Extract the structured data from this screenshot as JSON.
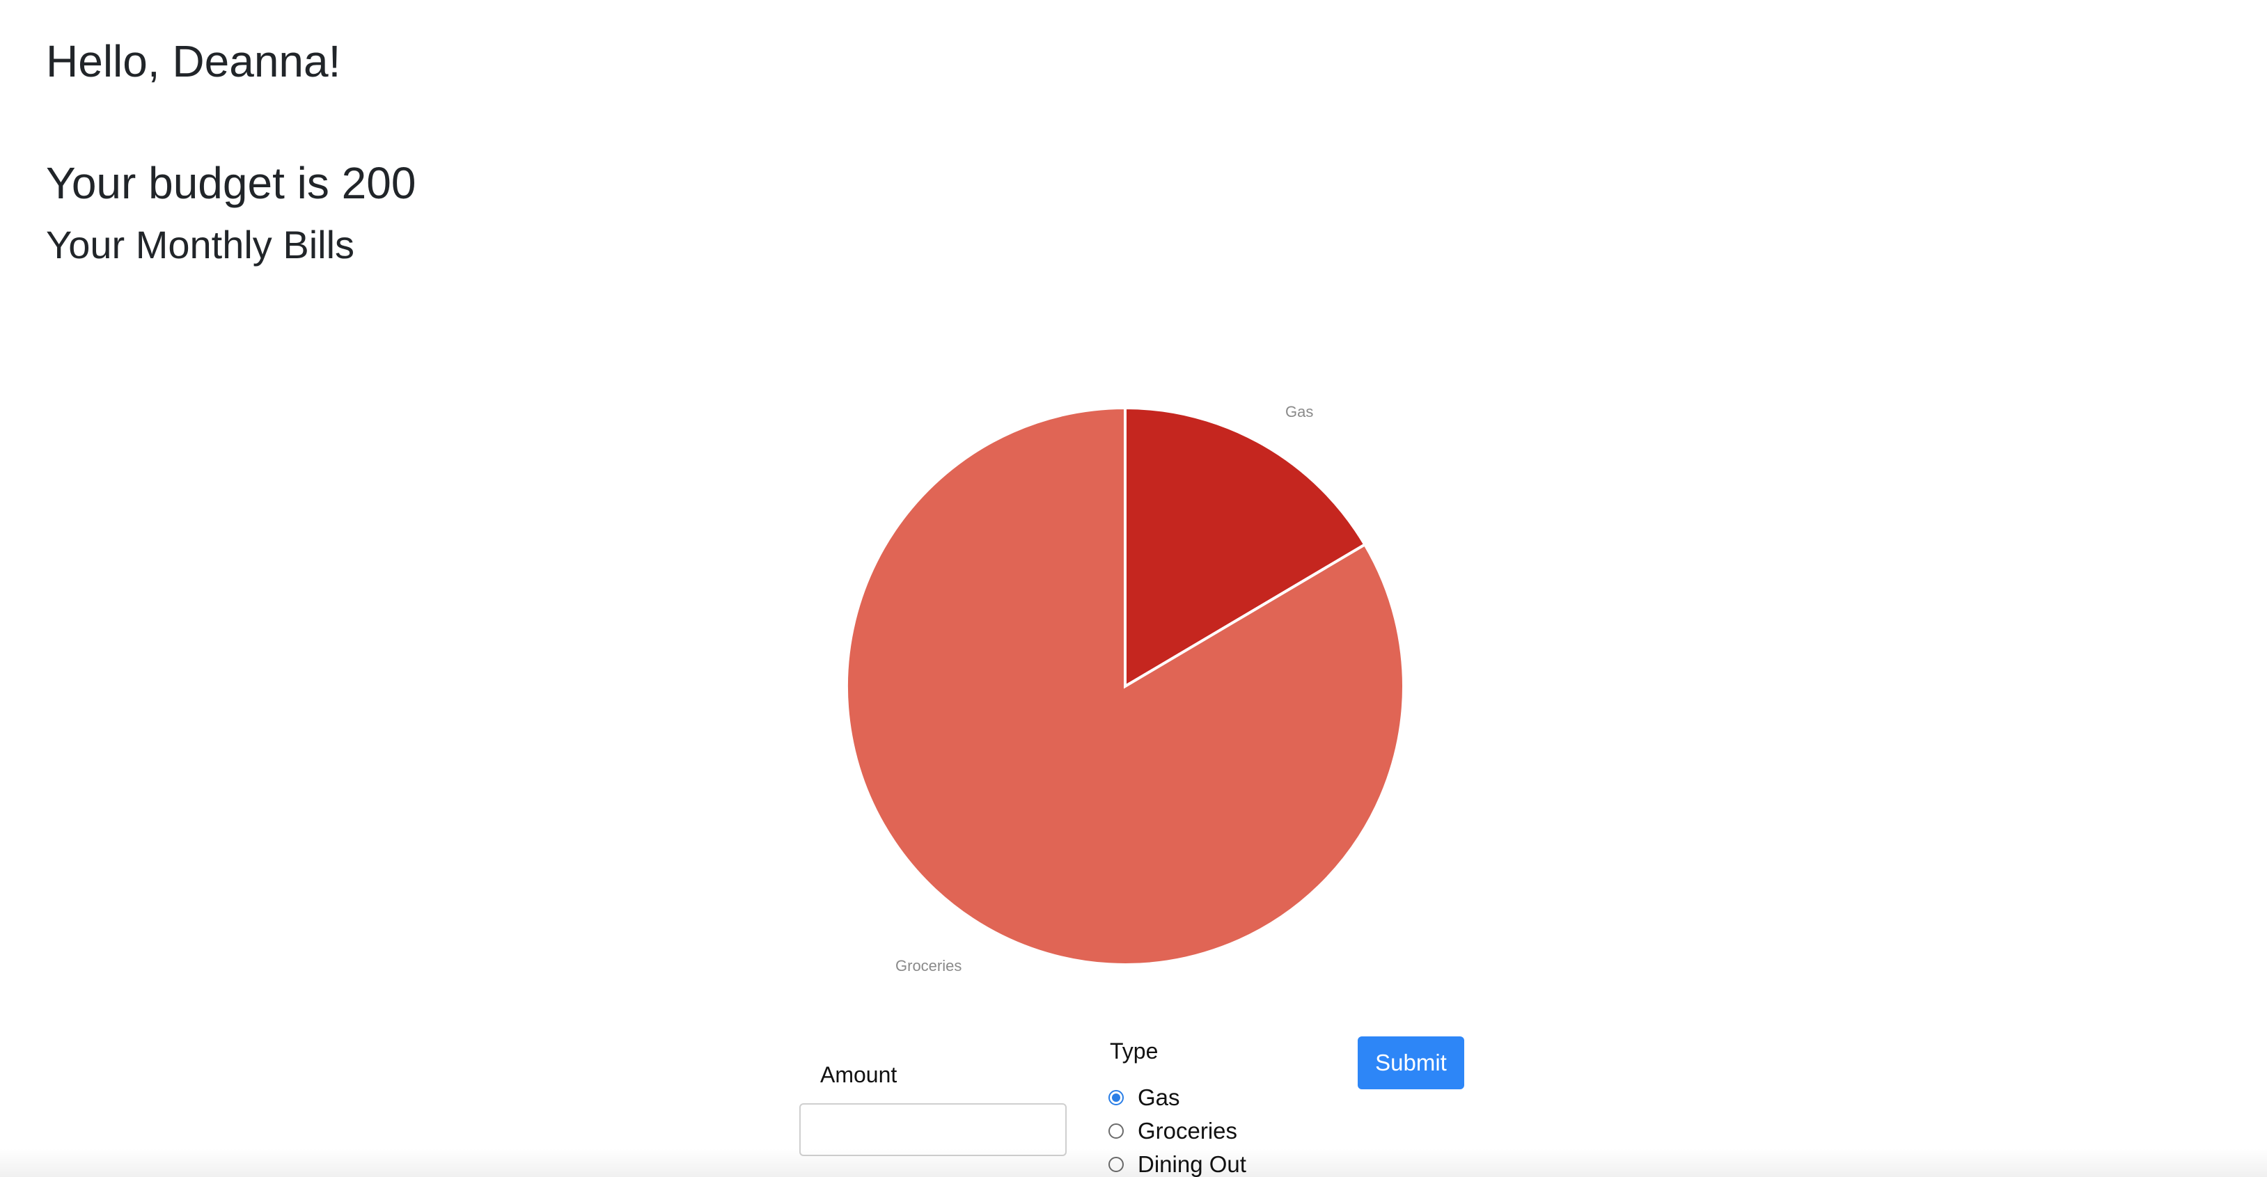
{
  "header": {
    "greeting": "Hello, Deanna!",
    "budget_text": "Your budget is 200",
    "bills_title": "Your Monthly Bills"
  },
  "chart_data": {
    "type": "pie",
    "slices": [
      {
        "label": "Gas",
        "value": 16.5,
        "color": "#c5261f"
      },
      {
        "label": "Groceries",
        "value": 83.5,
        "color": "#e06555"
      }
    ],
    "legend": "none"
  },
  "form": {
    "amount_label": "Amount",
    "amount_value": "",
    "amount_placeholder": "",
    "type_label": "Type",
    "options": [
      {
        "label": "Gas",
        "checked": true
      },
      {
        "label": "Groceries",
        "checked": false
      },
      {
        "label": "Dining Out",
        "checked": false
      }
    ],
    "submit_label": "Submit"
  },
  "colors": {
    "accent": "#2d86f7"
  }
}
